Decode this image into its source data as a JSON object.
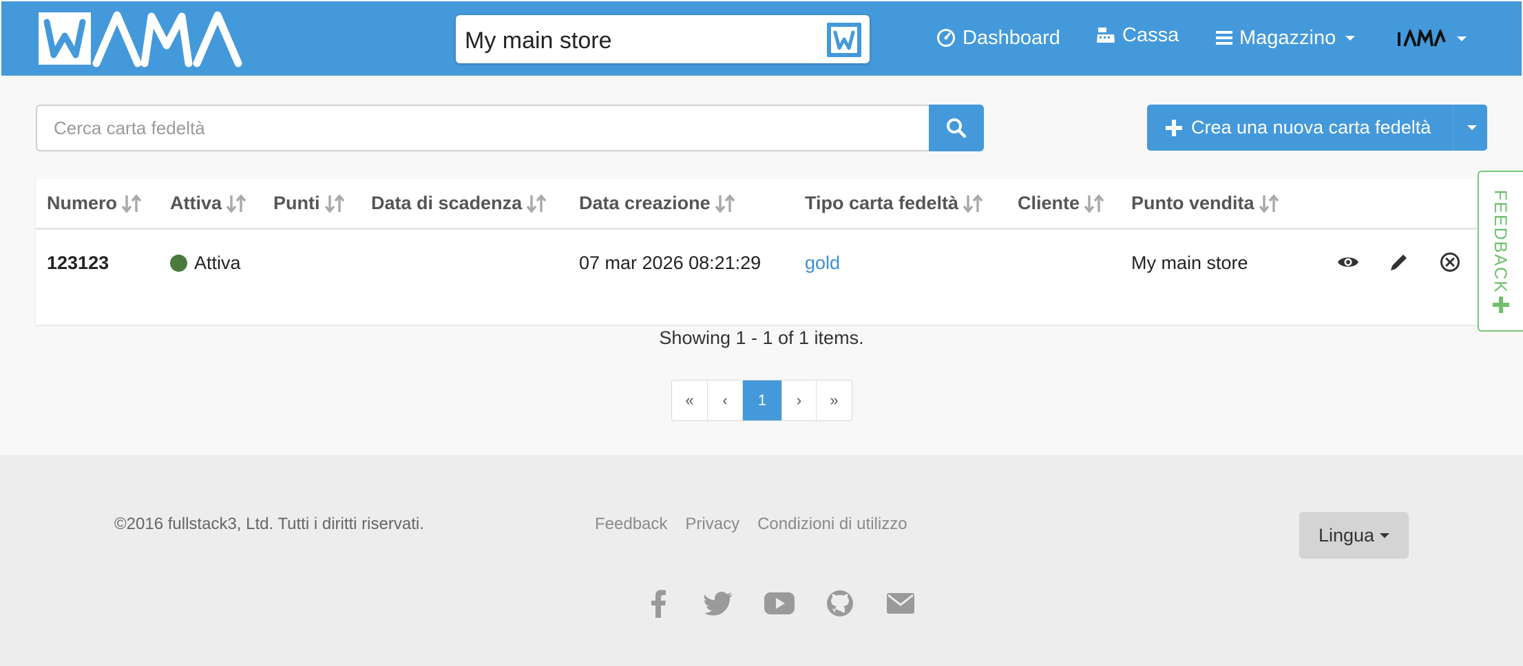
{
  "brand": {
    "name": "WAMA"
  },
  "navbar": {
    "store_name": "My main store",
    "items": [
      {
        "label": "Dashboard",
        "icon": "dashboard-icon"
      },
      {
        "label": "Cassa",
        "icon": "cash-register-icon"
      },
      {
        "label": "Magazzino",
        "icon": "bars-icon"
      }
    ],
    "user_menu_icon": "wama-avatar-icon"
  },
  "search": {
    "placeholder": "Cerca carta fedeltà",
    "value": ""
  },
  "create_button": {
    "label": "Crea una nuova carta fedeltà"
  },
  "table": {
    "columns": [
      "Numero",
      "Attiva",
      "Punti",
      "Data di scadenza",
      "Data creazione",
      "Tipo carta fedeltà",
      "Cliente",
      "Punto vendita"
    ],
    "rows": [
      {
        "numero": "123123",
        "attiva": "Attiva",
        "punti": "",
        "data_scadenza": "",
        "data_creazione": "07 mar 2026 08:21:29",
        "tipo": "gold",
        "cliente": "",
        "punto_vendita": "My main store"
      }
    ]
  },
  "summary": "Showing 1 - 1 of 1 items.",
  "pagination": {
    "first": "«",
    "prev": "‹",
    "current": "1",
    "next": "›",
    "last": "»"
  },
  "feedback_tab": {
    "label": "FEEDBACK"
  },
  "footer": {
    "copyright": "©2016 fullstack3, Ltd. Tutti i diritti riservati.",
    "links": [
      "Feedback",
      "Privacy",
      "Condizioni di utilizzo"
    ],
    "language_button": "Lingua",
    "socials": [
      "facebook-icon",
      "twitter-icon",
      "youtube-icon",
      "github-icon",
      "envelope-icon"
    ]
  },
  "colors": {
    "primary": "#4499db",
    "active_status": "#4a7a3e",
    "feedback_green": "#6fbf6e",
    "footer_bg": "#ededed"
  }
}
